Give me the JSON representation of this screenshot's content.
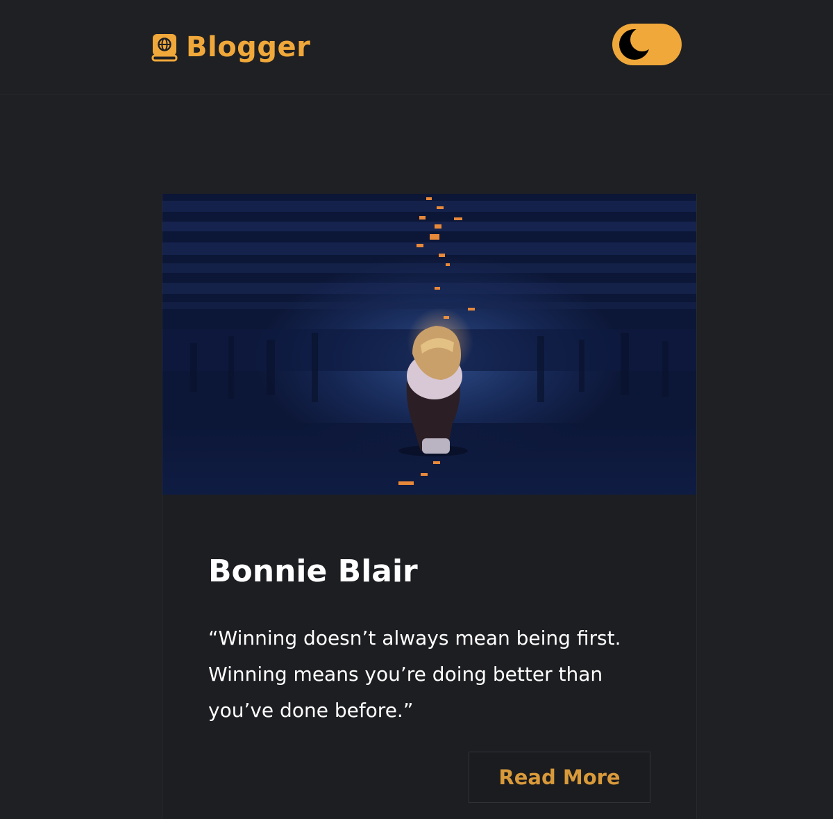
{
  "header": {
    "brand_name": "Blogger",
    "logo_icon": "book-globe-icon",
    "theme_toggle_icon": "moon-icon"
  },
  "post": {
    "image_icon": "girl-sitting-in-dark-illustration",
    "title": "Bonnie Blair",
    "excerpt": "“Winning doesn’t always mean being first. Winning means you’re doing better than you’ve done before.”",
    "read_more_label": "Read More"
  },
  "colors": {
    "background": "#1f2024",
    "accent": "#f0a83a",
    "text": "#ffffff"
  }
}
